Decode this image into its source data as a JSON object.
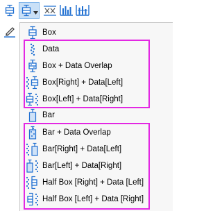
{
  "colors": {
    "menu_bg": "#f7f7f7",
    "highlight_border": "#e328e3",
    "icon_blue": "#1f6fd1",
    "active_button_bg": "#c9e0f7"
  },
  "toolbar": {
    "buttons": [
      {
        "icon": "box-chart-icon"
      },
      {
        "icon": "box-chart-dropdown-icon",
        "active": true
      },
      {
        "icon": "column-scatter-icon"
      },
      {
        "icon": "grouped-columns-icon"
      },
      {
        "icon": "double-y-columns-icon"
      }
    ]
  },
  "side_strip": {
    "icon": "pencil-icon"
  },
  "menu": {
    "items": [
      {
        "label": "Box",
        "icon": "box-icon"
      },
      {
        "label": "Data",
        "icon": "data-points-icon"
      },
      {
        "label": "Box + Data Overlap",
        "icon": "box-data-overlap-icon"
      },
      {
        "label": "Box[Right] + Data[Left]",
        "icon": "box-right-data-left-icon"
      },
      {
        "label": "Box[Left] + Data[Right]",
        "icon": "box-left-data-right-icon"
      },
      {
        "label": "Bar",
        "icon": "bar-icon"
      },
      {
        "label": "Bar + Data Overlap",
        "icon": "bar-data-overlap-icon"
      },
      {
        "label": "Bar[Right] + Data[Left]",
        "icon": "bar-right-data-left-icon"
      },
      {
        "label": "Bar[Left] + Data[Right]",
        "icon": "bar-left-data-right-icon"
      },
      {
        "label": "Half Box [Right] + Data [Left]",
        "icon": "half-box-right-data-left-icon"
      },
      {
        "label": "Half Box [Left] + Data [Right]",
        "icon": "half-box-left-data-right-icon"
      }
    ]
  }
}
